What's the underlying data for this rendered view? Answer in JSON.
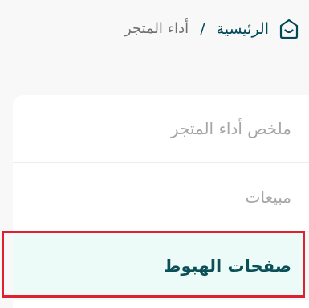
{
  "breadcrumb": {
    "home_label": "الرئيسية",
    "separator": "/",
    "current_label": "أداء المتجر",
    "home_icon": "store-smile-icon"
  },
  "menu": {
    "items": [
      {
        "label": "ملخص أداء المتجر",
        "active": false
      },
      {
        "label": "مبيعات",
        "active": false
      },
      {
        "label": "صفحات الهبوط",
        "active": true
      }
    ]
  },
  "colors": {
    "brand": "#004956",
    "active_bg": "#edfbf8",
    "highlight": "#e0202e",
    "muted_text": "#a6a6a6"
  }
}
